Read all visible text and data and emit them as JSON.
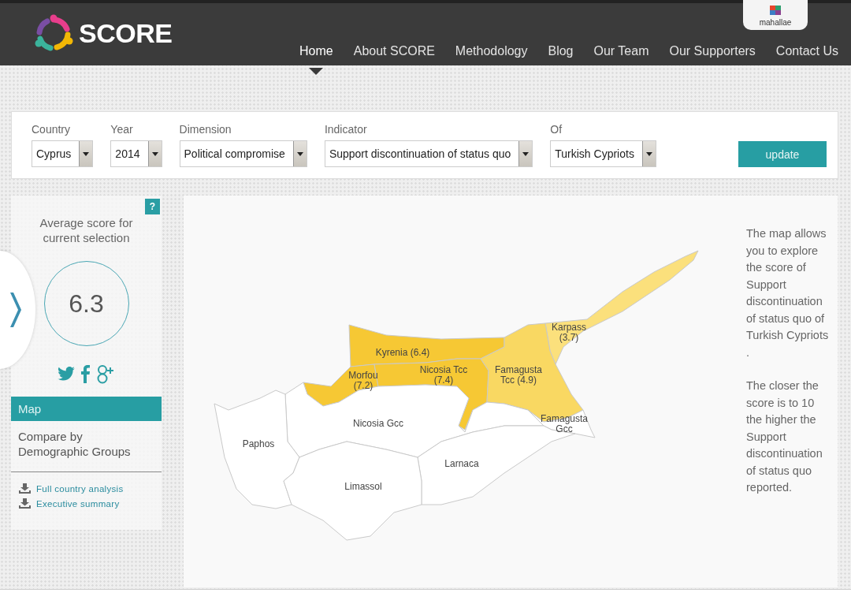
{
  "header": {
    "logo": "SCORE",
    "partner_badge": "mahallae",
    "nav": [
      {
        "label": "Home",
        "selected": true
      },
      {
        "label": "About SCORE",
        "selected": false
      },
      {
        "label": "Methodology",
        "selected": false
      },
      {
        "label": "Blog",
        "selected": false
      },
      {
        "label": "Our Team",
        "selected": false
      },
      {
        "label": "Our Supporters",
        "selected": false
      },
      {
        "label": "Contact Us",
        "selected": false
      }
    ]
  },
  "filters": {
    "fields": [
      {
        "label": "Country",
        "value": "Cyprus"
      },
      {
        "label": "Year",
        "value": "2014"
      },
      {
        "label": "Dimension",
        "value": "Political compromise"
      },
      {
        "label": "Indicator",
        "value": "Support discontinuation of status quo"
      },
      {
        "label": "Of",
        "value": "Turkish Cypriots"
      }
    ],
    "button": "update"
  },
  "sidebar": {
    "help": "?",
    "score_caption": "Average score for current selection",
    "score": "6.3",
    "views": [
      {
        "label": "Map",
        "selected": true
      },
      {
        "label": "Compare by Demographic Groups",
        "selected": false
      }
    ],
    "downloads": [
      "Full country analysis",
      "Executive summary"
    ]
  },
  "map": {
    "regions": [
      {
        "label": [
          "Karpass",
          "(3.7)"
        ],
        "color": "#fbe07c"
      },
      {
        "label": [
          "Kyrenia (6.4)"
        ],
        "color": "#f6c834"
      },
      {
        "label": [
          "Morfou",
          "(7.2)"
        ],
        "color": "#f6c834"
      },
      {
        "label": [
          "Nicosia Tcc",
          "(7.4)"
        ],
        "color": "#f6c834"
      },
      {
        "label": [
          "Famagusta",
          "Tcc (4.9)"
        ],
        "color": "#f9d862"
      },
      {
        "label": [
          "Nicosia Gcc"
        ],
        "color": "#ffffff"
      },
      {
        "label": [
          "Famagusta",
          "Gcc"
        ],
        "color": "#ffffff"
      },
      {
        "label": [
          "Paphos"
        ],
        "color": "#ffffff"
      },
      {
        "label": [
          "Larnaca"
        ],
        "color": "#ffffff"
      },
      {
        "label": [
          "Limassol"
        ],
        "color": "#ffffff"
      }
    ],
    "description": [
      "The map allows you to explore the score of Support discontinuation of status quo of Turkish Cypriots .",
      "The closer the score is to 10 the higher the Support discontinuation of status quo reported."
    ]
  }
}
